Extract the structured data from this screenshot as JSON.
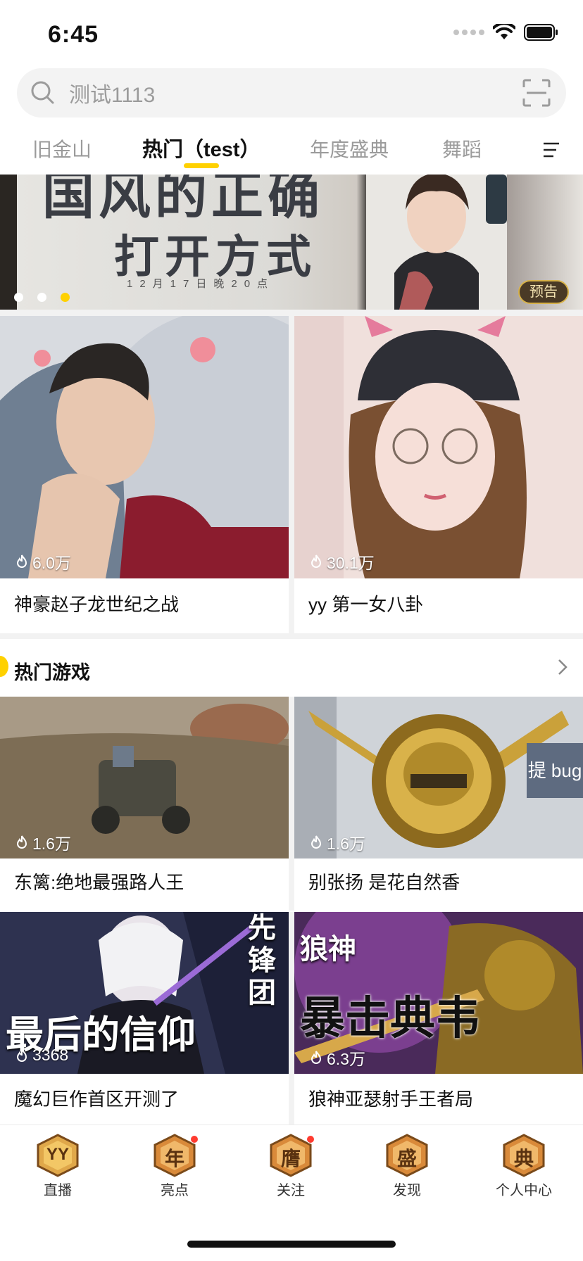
{
  "status_bar": {
    "time": "6:45"
  },
  "search": {
    "placeholder": "测试1113"
  },
  "tabs": [
    {
      "label": "旧金山"
    },
    {
      "label": "热门（test）"
    },
    {
      "label": "年度盛典"
    },
    {
      "label": "舞蹈"
    }
  ],
  "banner": {
    "title_line1": "国风的正确",
    "title_line2": "打开方式",
    "date": "12月17日晚20点",
    "badge": "预告",
    "slide_count": 3,
    "active_slide": 3
  },
  "featured_cards": [
    {
      "heat": "6.0万",
      "title": "神豪赵子龙世纪之战"
    },
    {
      "heat": "30.1万",
      "title": "yy 第一女八卦"
    }
  ],
  "hot_games": {
    "section_title": "热门游戏",
    "cards": [
      {
        "heat": "1.6万",
        "title": "东篱:绝地最强路人王"
      },
      {
        "heat": "1.6万",
        "title": "别张扬 是花自然香"
      },
      {
        "heat": "3368",
        "title": "魔幻巨作首区开测了",
        "thumb_text_1": "最后的信仰",
        "thumb_text_2": "先锋团"
      },
      {
        "heat": "6.3万",
        "title": "狼神亚瑟射手王者局",
        "thumb_text_1": "狼神",
        "thumb_text_2": "暴击典韦"
      }
    ]
  },
  "bug_button": {
    "label": "提 bug"
  },
  "bottom_nav": [
    {
      "icon_text": "YY",
      "label": "直播",
      "badge": false
    },
    {
      "icon_text": "年",
      "label": "亮点",
      "badge": true
    },
    {
      "icon_text": "膺",
      "label": "关注",
      "badge": true
    },
    {
      "icon_text": "盛",
      "label": "发现",
      "badge": false
    },
    {
      "icon_text": "典",
      "label": "个人中心",
      "badge": false
    }
  ],
  "colors": {
    "accent": "#ffd100",
    "badge_red": "#ff3b30",
    "bug_button": "#5e6b80",
    "nav_gold": "#c8822a"
  }
}
